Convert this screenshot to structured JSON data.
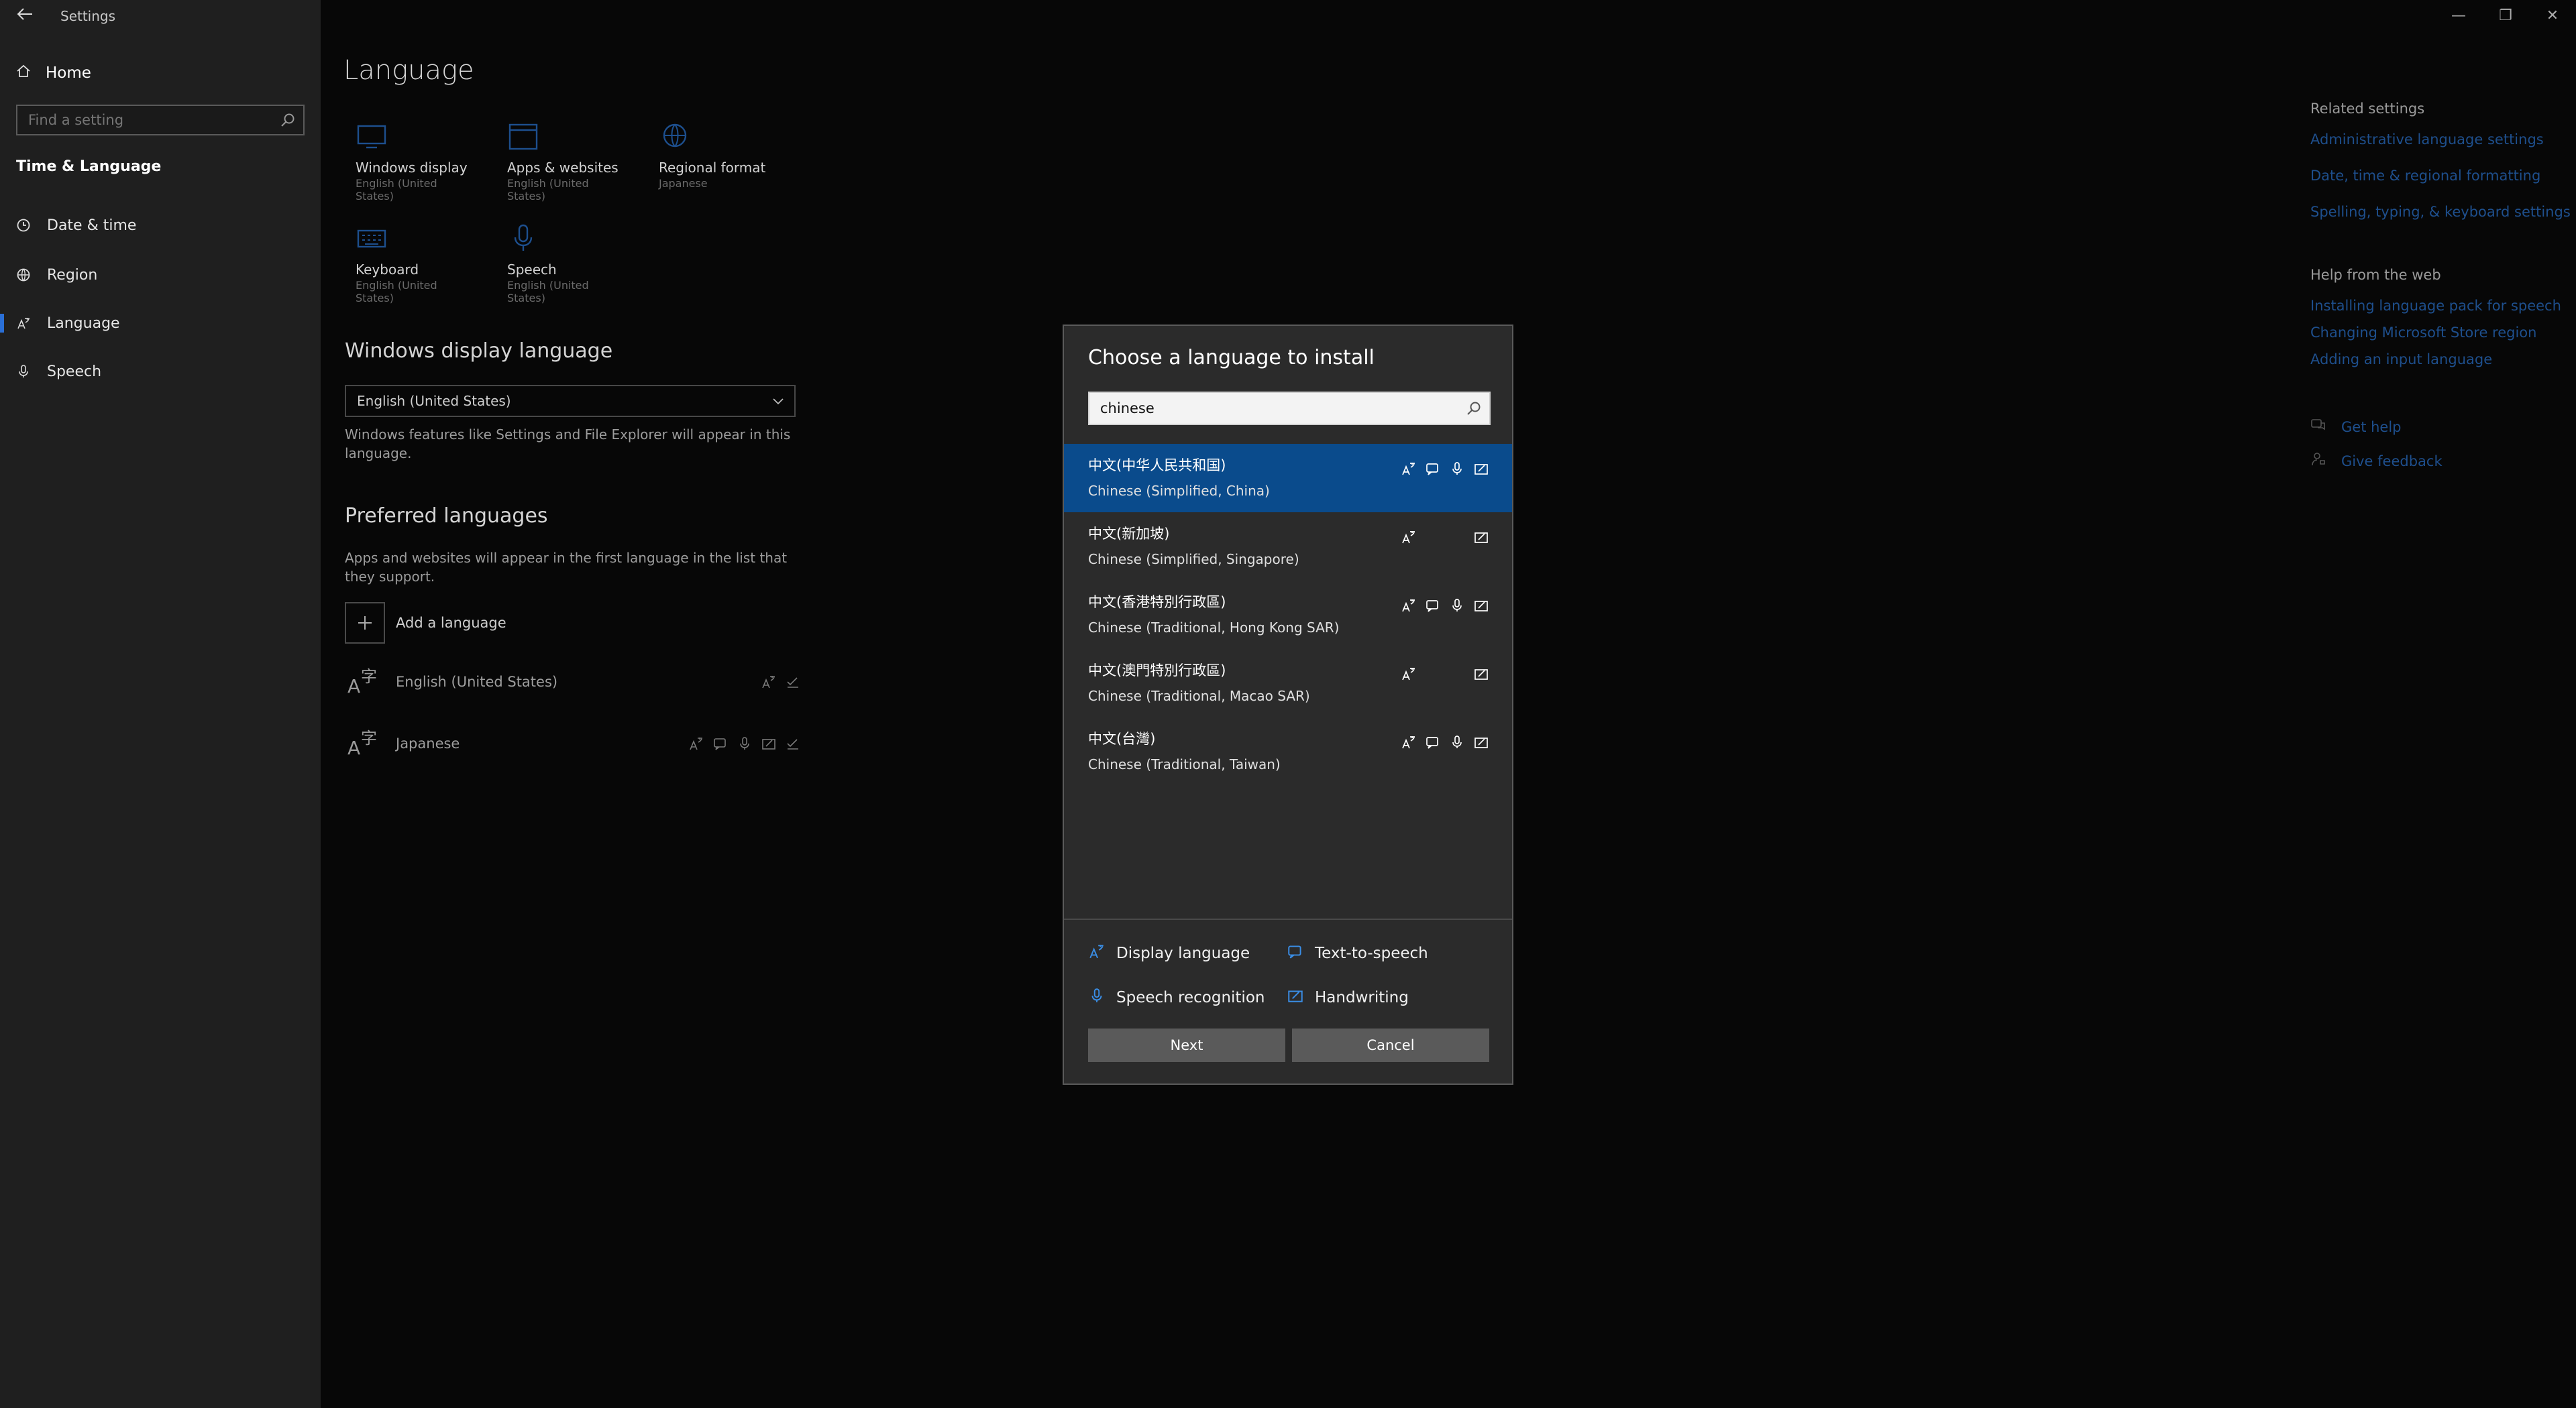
{
  "window": {
    "title": "Settings",
    "minimize_glyph": "—",
    "restore_glyph": "❐",
    "close_glyph": "✕"
  },
  "sidebar": {
    "home_label": "Home",
    "search_placeholder": "Find a setting",
    "section_label": "Time & Language",
    "items": [
      {
        "label": "Date & time",
        "icon": "clock-icon"
      },
      {
        "label": "Region",
        "icon": "globe-icon"
      },
      {
        "label": "Language",
        "icon": "language-icon",
        "active": true
      },
      {
        "label": "Speech",
        "icon": "microphone-icon"
      }
    ]
  },
  "main": {
    "page_title": "Language",
    "tiles": [
      {
        "name": "Windows display",
        "sub": "English (United States)",
        "icon": "monitor-icon"
      },
      {
        "name": "Apps & websites",
        "sub": "English (United States)",
        "icon": "window-icon"
      },
      {
        "name": "Regional format",
        "sub": "Japanese",
        "icon": "globe-icon"
      },
      {
        "name": "Keyboard",
        "sub": "English (United States)",
        "icon": "keyboard-icon"
      },
      {
        "name": "Speech",
        "sub": "English (United States)",
        "icon": "microphone-icon"
      }
    ],
    "display_language_heading": "Windows display language",
    "display_language_value": "English (United States)",
    "display_language_note": "Windows features like Settings and File Explorer will appear in this language.",
    "preferred_heading": "Preferred languages",
    "preferred_note": "Apps and websites will appear in the first language in the list that they support.",
    "add_language_label": "Add a language",
    "preferred": [
      {
        "name": "English (United States)"
      },
      {
        "name": "Japanese"
      }
    ]
  },
  "related": {
    "heading": "Related settings",
    "links": [
      "Administrative language settings",
      "Date, time & regional formatting",
      "Spelling, typing, & keyboard settings"
    ],
    "help_heading": "Help from the web",
    "help_links": [
      "Installing language pack for speech",
      "Changing Microsoft Store region",
      "Adding an input language"
    ],
    "get_help": "Get help",
    "give_feedback": "Give feedback"
  },
  "dialog": {
    "title": "Choose a language to install",
    "search_value": "chinese",
    "languages": [
      {
        "native": "中文(中华人民共和国)",
        "english": "Chinese (Simplified, China)",
        "selected": true,
        "display": true,
        "tts": true,
        "speech": true,
        "handwriting": true
      },
      {
        "native": "中文(新加坡)",
        "english": "Chinese (Simplified, Singapore)",
        "selected": false,
        "display": true,
        "tts": false,
        "speech": false,
        "handwriting": true
      },
      {
        "native": "中文(香港特別行政區)",
        "english": "Chinese (Traditional, Hong Kong SAR)",
        "selected": false,
        "display": true,
        "tts": true,
        "speech": true,
        "handwriting": true
      },
      {
        "native": "中文(澳門特別行政區)",
        "english": "Chinese (Traditional, Macao SAR)",
        "selected": false,
        "display": true,
        "tts": false,
        "speech": false,
        "handwriting": true
      },
      {
        "native": "中文(台灣)",
        "english": "Chinese (Traditional, Taiwan)",
        "selected": false,
        "display": true,
        "tts": true,
        "speech": true,
        "handwriting": true
      }
    ],
    "legend": {
      "display": "Display language",
      "tts": "Text-to-speech",
      "speech": "Speech recognition",
      "handwriting": "Handwriting"
    },
    "next_label": "Next",
    "cancel_label": "Cancel",
    "accent_color": "#0a4b8c",
    "icon_color": "#3a8ee6"
  }
}
